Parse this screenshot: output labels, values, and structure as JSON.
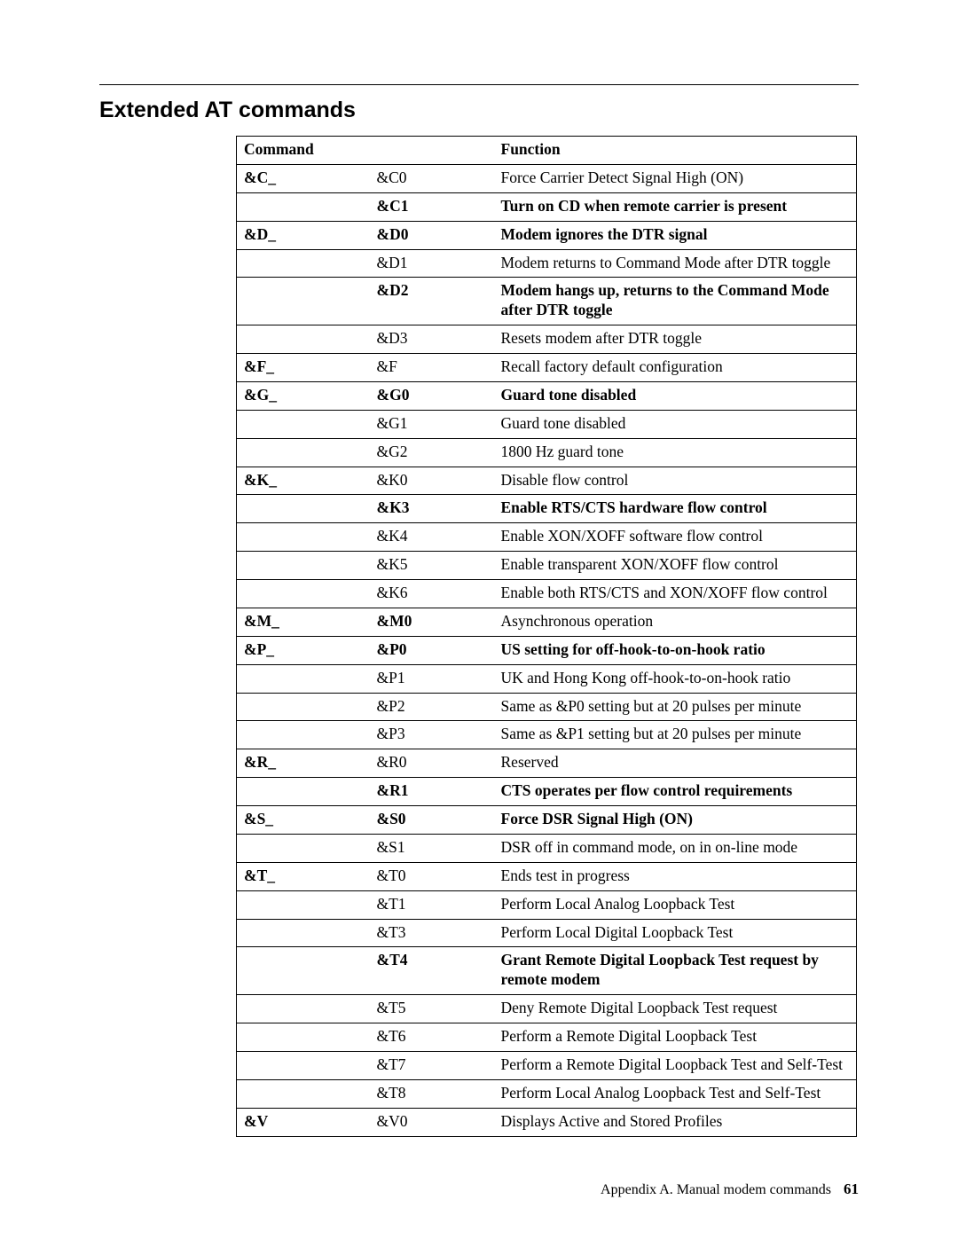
{
  "section_title": "Extended AT commands",
  "table": {
    "headers": {
      "command": "Command",
      "function": "Function"
    },
    "rows": [
      {
        "cmd": "&C_",
        "set": "&C0",
        "func": "Force Carrier Detect Signal High (ON)",
        "cmd_b": true
      },
      {
        "cmd": "",
        "set": "&C1",
        "func": "Turn on CD when remote carrier is present",
        "set_b": true,
        "func_b": true
      },
      {
        "cmd": "&D_",
        "set": "&D0",
        "func": "Modem ignores the DTR signal",
        "cmd_b": true,
        "set_b": true,
        "func_b": true
      },
      {
        "cmd": "",
        "set": "&D1",
        "func": "Modem returns to Command Mode after DTR toggle"
      },
      {
        "cmd": "",
        "set": "&D2",
        "func": "Modem hangs up, returns to the Command Mode after DTR toggle",
        "set_b": true,
        "func_b": true
      },
      {
        "cmd": "",
        "set": "&D3",
        "func": "Resets modem after DTR toggle"
      },
      {
        "cmd": "&F_",
        "set": "&F",
        "func": "Recall factory default configuration",
        "cmd_b": true
      },
      {
        "cmd": "&G_",
        "set": "&G0",
        "func": "Guard tone disabled",
        "cmd_b": true,
        "set_b": true,
        "func_b": true
      },
      {
        "cmd": "",
        "set": "&G1",
        "func": "Guard tone disabled"
      },
      {
        "cmd": "",
        "set": "&G2",
        "func": "1800 Hz guard tone"
      },
      {
        "cmd": "&K_",
        "set": "&K0",
        "func": "Disable flow control",
        "cmd_b": true
      },
      {
        "cmd": "",
        "set": "&K3",
        "func": "Enable RTS/CTS hardware flow control",
        "set_b": true,
        "func_b": true
      },
      {
        "cmd": "",
        "set": "&K4",
        "func": "Enable XON/XOFF software flow control"
      },
      {
        "cmd": "",
        "set": "&K5",
        "func": "Enable transparent XON/XOFF flow control"
      },
      {
        "cmd": "",
        "set": "&K6",
        "func": "Enable both RTS/CTS and XON/XOFF flow control"
      },
      {
        "cmd": "&M_",
        "set": "&M0",
        "func": "Asynchronous operation",
        "cmd_b": true,
        "set_b": true
      },
      {
        "cmd": "&P_",
        "set": "&P0",
        "func": "US setting for off-hook-to-on-hook ratio",
        "cmd_b": true,
        "set_b": true,
        "func_b": true
      },
      {
        "cmd": "",
        "set": "&P1",
        "func": "UK and Hong Kong off-hook-to-on-hook ratio"
      },
      {
        "cmd": "",
        "set": "&P2",
        "func": "Same as &P0 setting but at 20 pulses per minute"
      },
      {
        "cmd": "",
        "set": "&P3",
        "func": "Same as &P1 setting but at 20 pulses per minute"
      },
      {
        "cmd": "&R_",
        "set": "&R0",
        "func": "Reserved",
        "cmd_b": true
      },
      {
        "cmd": "",
        "set": "&R1",
        "func": "CTS operates per flow control requirements",
        "set_b": true,
        "func_b": true
      },
      {
        "cmd": "&S_",
        "set": "&S0",
        "func": "Force DSR Signal High (ON)",
        "cmd_b": true,
        "set_b": true,
        "func_b": true
      },
      {
        "cmd": "",
        "set": "&S1",
        "func": "DSR off in command mode, on in on-line mode"
      },
      {
        "cmd": "&T_",
        "set": "&T0",
        "func": "Ends test in progress",
        "cmd_b": true
      },
      {
        "cmd": "",
        "set": "&T1",
        "func": "Perform Local Analog Loopback Test"
      },
      {
        "cmd": "",
        "set": "&T3",
        "func": "Perform Local Digital Loopback Test"
      },
      {
        "cmd": "",
        "set": "&T4",
        "func": "Grant Remote Digital Loopback Test request by remote modem",
        "set_b": true,
        "func_b": true
      },
      {
        "cmd": "",
        "set": "&T5",
        "func": "Deny Remote Digital Loopback Test request"
      },
      {
        "cmd": "",
        "set": "&T6",
        "func": "Perform a Remote Digital Loopback Test"
      },
      {
        "cmd": "",
        "set": "&T7",
        "func": "Perform a Remote Digital Loopback Test and Self-Test"
      },
      {
        "cmd": "",
        "set": "&T8",
        "func": "Perform Local Analog Loopback Test and Self-Test"
      },
      {
        "cmd": "&V",
        "set": "&V0",
        "func": "Displays Active and Stored Profiles",
        "cmd_b": true
      }
    ]
  },
  "footer": {
    "text": "Appendix A. Manual modem commands",
    "page": "61"
  }
}
